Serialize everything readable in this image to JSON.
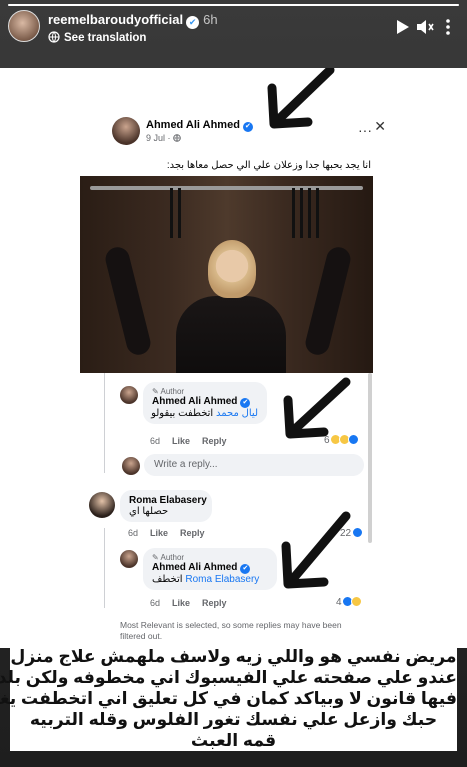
{
  "story": {
    "username": "reemelbaroudyofficial",
    "time": "6h",
    "see_translation": "See translation",
    "progress_fraction": 1.0
  },
  "post": {
    "author": "Ahmed Ali Ahmed",
    "date": "9 Jul",
    "date_privacy_icon": "globe-icon",
    "text": "انا يجد بحبها جدا وزعلان علي الي حصل معاها بجد:"
  },
  "comments": [
    {
      "tag": "Author",
      "name": "Ahmed Ali Ahmed",
      "mention": "ليال محمد",
      "text": "اتخطفت بيقولو",
      "time": "6d",
      "like": "Like",
      "reply": "Reply",
      "reactions": "6"
    },
    {
      "name": "Roma Elabasery",
      "text": "حصلها اي",
      "time": "6d",
      "like": "Like",
      "reply": "Reply",
      "reactions": "22"
    },
    {
      "tag": "Author",
      "name": "Ahmed Ali Ahmed",
      "mention": "Roma Elabasery",
      "text": "اتخطف",
      "time": "6d",
      "like": "Like",
      "reply": "Reply",
      "reactions": "4"
    }
  ],
  "reply_placeholder": "Write a reply...",
  "relevant_note": "Most Relevant is selected, so some replies may have been filtered out.",
  "caption": [
    "مريض نفسي هو واللي زيه ولاسف ملهمش علاج  منزل",
    "عندو علي صفحته علي الفيسبوك اني مخطوفه ولكن بلدنا",
    "فيها قانون لا وبياكد كمان في كل تعليق اني اتخطفت يغور",
    "حبك وازعل علي نفسك تغور الفلوس وقله التربيه",
    "قمه العبث"
  ],
  "colors": {
    "facebook_blue": "#1877f2",
    "instagram_verified": "#3897f0",
    "arrow": "#111111"
  }
}
